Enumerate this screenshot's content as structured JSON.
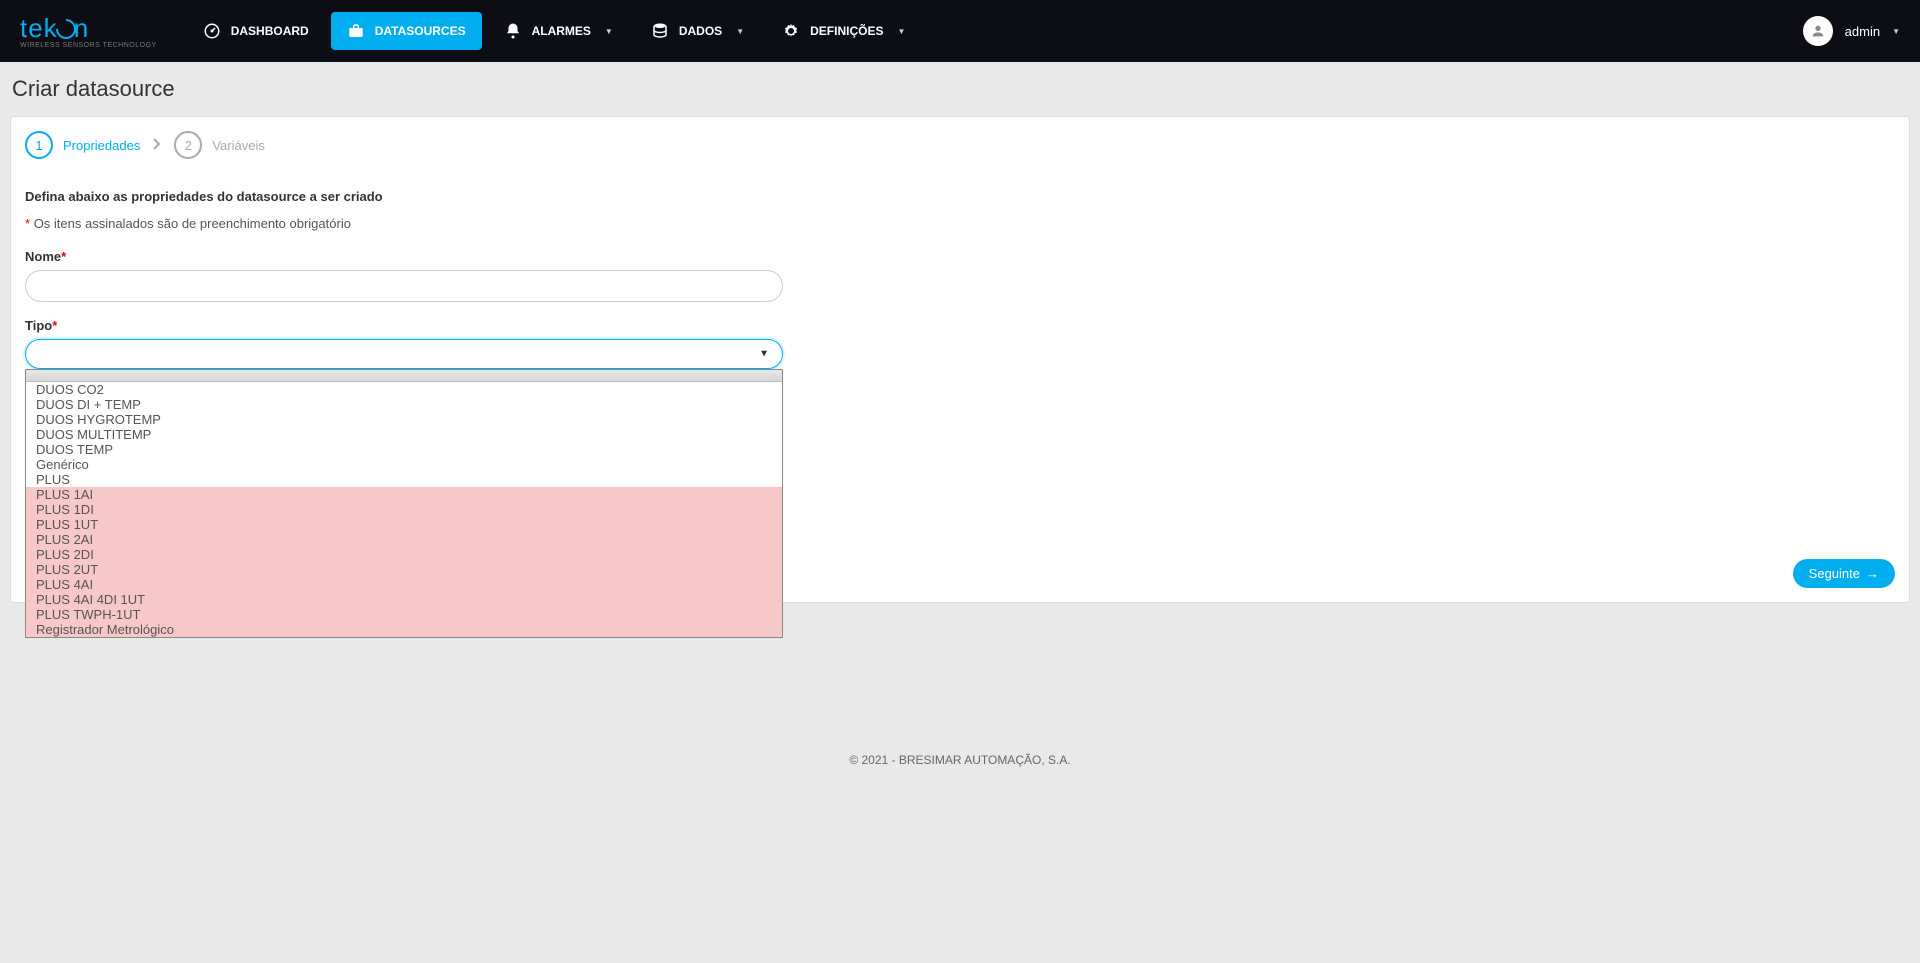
{
  "brand": {
    "name": "tekon",
    "tagline": "WIRELESS SENSORS TECHNOLOGY"
  },
  "nav": {
    "dashboard": "DASHBOARD",
    "datasources": "DATASOURCES",
    "alarmes": "ALARMES",
    "dados": "DADOS",
    "definicoes": "DEFINIÇÕES"
  },
  "user": {
    "name": "admin"
  },
  "page": {
    "title": "Criar datasource",
    "step1_num": "1",
    "step1_label": "Propriedades",
    "step2_num": "2",
    "step2_label": "Variáveis",
    "intro": "Defina abaixo as propriedades do datasource a ser criado",
    "required_note": "Os itens assinalados são de preenchimento obrigatório",
    "nome_label": "Nome",
    "tipo_label": "Tipo",
    "next_button": "Seguinte"
  },
  "dropdown": {
    "items": [
      {
        "label": "DUOS CO2",
        "hl": false
      },
      {
        "label": "DUOS DI + TEMP",
        "hl": false
      },
      {
        "label": "DUOS HYGROTEMP",
        "hl": false
      },
      {
        "label": "DUOS MULTITEMP",
        "hl": false
      },
      {
        "label": "DUOS TEMP",
        "hl": false
      },
      {
        "label": "Genérico",
        "hl": false
      },
      {
        "label": "PLUS",
        "hl": false
      },
      {
        "label": "PLUS 1AI",
        "hl": true
      },
      {
        "label": "PLUS 1DI",
        "hl": true
      },
      {
        "label": "PLUS 1UT",
        "hl": true
      },
      {
        "label": "PLUS 2AI",
        "hl": true
      },
      {
        "label": "PLUS 2DI",
        "hl": true
      },
      {
        "label": "PLUS 2UT",
        "hl": true
      },
      {
        "label": "PLUS 4AI",
        "hl": true
      },
      {
        "label": "PLUS 4AI 4DI 1UT",
        "hl": true
      },
      {
        "label": "PLUS TWPH-1UT",
        "hl": true
      },
      {
        "label": "Registrador Metrológico",
        "hl": true
      }
    ]
  },
  "footer": "© 2021 - BRESIMAR AUTOMAÇÃO, S.A."
}
